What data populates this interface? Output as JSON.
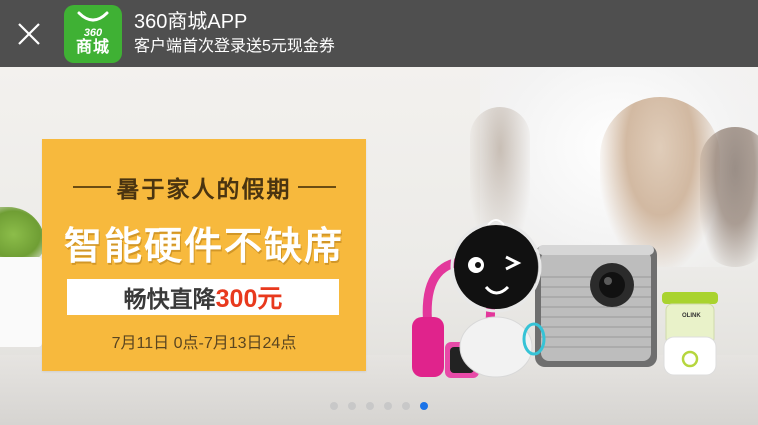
{
  "app_bar": {
    "title": "360商城APP",
    "subtitle": "客户端首次登录送5元现金券",
    "logo_number": "360",
    "logo_text": "商城",
    "close_icon": "close-icon"
  },
  "banner": {
    "tagline": "暑于家人的假期",
    "headline": "智能硬件不缺席",
    "price_prefix": "畅快直降",
    "price_amount": "300元",
    "date_range": "7月11日 0点-7月13日24点",
    "product_brand": "OLINK",
    "colors": {
      "promo_bg": "#f7b93d",
      "price_red": "#e8391d",
      "active_dot": "#1a73e8",
      "app_bar_bg": "#4f4f4f",
      "logo_green": "#3fb134"
    }
  },
  "carousel": {
    "dot_count": 6,
    "active_index": 5
  }
}
